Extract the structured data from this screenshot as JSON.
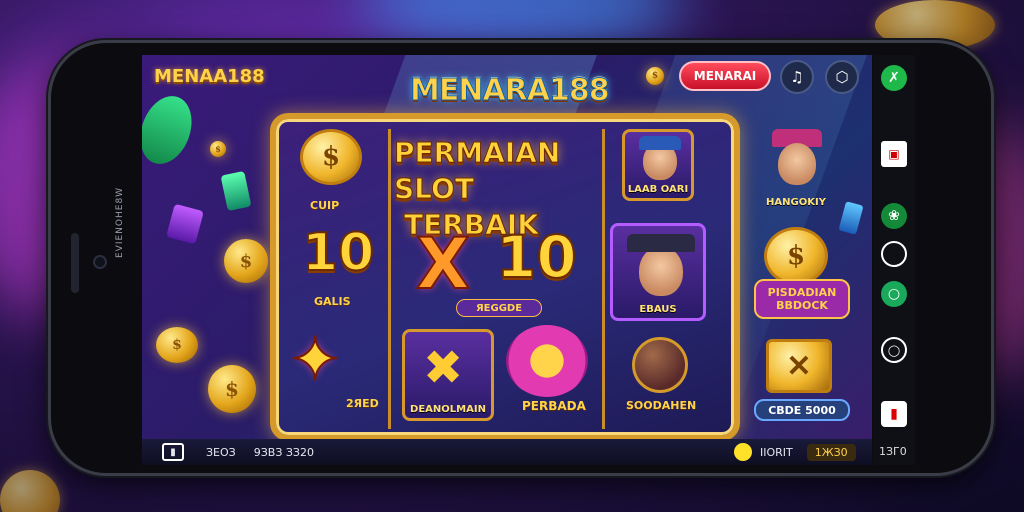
{
  "brand": {
    "left_logo": "MENAA188",
    "center_logo": "MENARA188"
  },
  "header": {
    "menu_button": "MENARAI"
  },
  "banner": {
    "title_line1": "PERMAIAN SLOT",
    "title_line2": "TERBAIK"
  },
  "reels": {
    "coin_label": "CUIP",
    "left_value": "10",
    "left_label": "GALIS",
    "left_bottom_label": "2ЯЕD",
    "center_value": "10",
    "center_prefix": "X",
    "center_pill": "ЯЕGGDE",
    "bell_label": "DEANOLMAIN",
    "flower_label": "PERBADA"
  },
  "cards": {
    "top_right": "LAAB OARI",
    "middle_right": "EBAUS",
    "bottom_right": "SOODAHEN"
  },
  "side_panel": {
    "character_label": "HANGOKIY",
    "promo_line1": "PISDADIAN",
    "promo_line2": "BBDOCK",
    "amount_pill": "CBDE 5000"
  },
  "bottom_bar": {
    "left_text_1": "ЗЕОЗ",
    "left_text_2": "9ЗВЗ ЗЗ20",
    "coin_text": "IIORIT",
    "coin_value": "1ЖЗ0",
    "right_value": "1ЗГ0"
  },
  "phone": {
    "side_text": "EVIENOHE8W"
  },
  "colors": {
    "gold": "#ffd24a",
    "frame": "#d59a2a",
    "menu_red": "#e3213a",
    "accent_green": "#1fb84a"
  },
  "icons": [
    "music-note-icon",
    "hexagon-icon",
    "green-share-icon",
    "notebook-icon",
    "leaf-icon",
    "circle-icon",
    "capsule-icon",
    "gamepad-icon",
    "red-card-icon",
    "dollar-coin-icon"
  ]
}
